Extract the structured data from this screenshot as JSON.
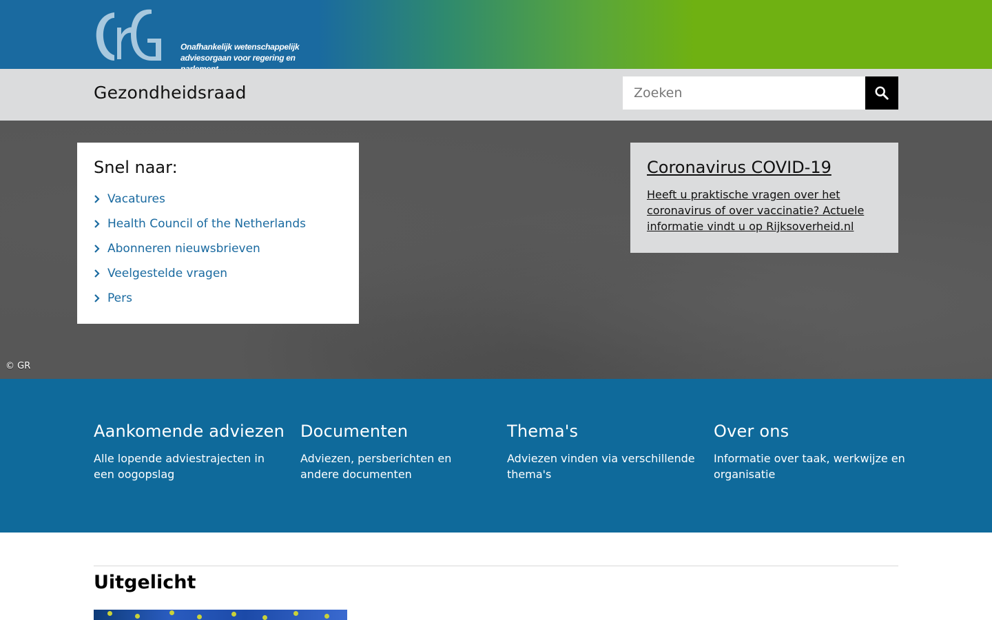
{
  "banner": {
    "logo_letters": "GR",
    "tagline_line1": "Onafhankelijk wetenschappelijk",
    "tagline_line2": "adviesorgaan voor regering en parlement",
    "colors": {
      "blue": "#1a6aa0",
      "green": "#6fb112"
    }
  },
  "header": {
    "site_title": "Gezondheidsraad",
    "search_placeholder": "Zoeken",
    "search_icon": "search-icon"
  },
  "hero": {
    "quick": {
      "title": "Snel naar:",
      "items": [
        {
          "label": "Vacatures"
        },
        {
          "label": "Health Council of the Netherlands"
        },
        {
          "label": "Abonneren nieuwsbrieven"
        },
        {
          "label": "Veelgestelde vragen"
        },
        {
          "label": "Pers"
        }
      ]
    },
    "covid": {
      "title": "Coronavirus COVID-19",
      "text": "Heeft u praktische vragen over het coronavirus of over vaccinatie? Actuele informatie vindt u op Rijksoverheid.nl"
    },
    "copyright": "© GR"
  },
  "nav_blocks": [
    {
      "title": "Aankomende adviezen",
      "desc": "Alle lopende adviestrajecten in een oogopslag"
    },
    {
      "title": "Documenten",
      "desc": "Adviezen, persberichten en andere documenten"
    },
    {
      "title": "Thema's",
      "desc": "Adviezen vinden via verschillende thema's"
    },
    {
      "title": "Over ons",
      "desc": "Informatie over taak, werkwijze en organisatie"
    }
  ],
  "featured": {
    "title": "Uitgelicht"
  }
}
